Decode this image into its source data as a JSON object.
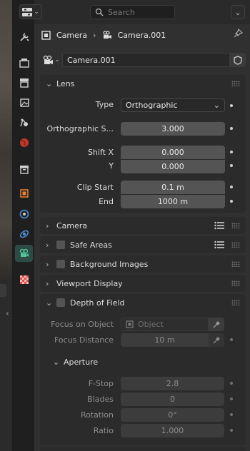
{
  "header": {
    "search_placeholder": "Search"
  },
  "breadcrumb": {
    "object": "Camera",
    "data": "Camera.001"
  },
  "datablock": {
    "name": "Camera.001"
  },
  "lens": {
    "title": "Lens",
    "type_label": "Type",
    "type_value": "Orthographic",
    "ortho_scale_label": "Orthographic S...",
    "ortho_scale_value": "3.000",
    "shift_x_label": "Shift X",
    "shift_x_value": "0.000",
    "shift_y_label": "Y",
    "shift_y_value": "0.000",
    "clip_start_label": "Clip Start",
    "clip_start_value": "0.1 m",
    "clip_end_label": "End",
    "clip_end_value": "1000 m"
  },
  "panels": {
    "camera": "Camera",
    "safe_areas": "Safe Areas",
    "background_images": "Background Images",
    "viewport_display": "Viewport Display",
    "depth_of_field": "Depth of Field"
  },
  "dof": {
    "focus_object_label": "Focus on Object",
    "focus_object_placeholder": "Object",
    "focus_distance_label": "Focus Distance",
    "focus_distance_value": "10 m",
    "aperture_title": "Aperture",
    "fstop_label": "F-Stop",
    "fstop_value": "2.8",
    "blades_label": "Blades",
    "blades_value": "0",
    "rotation_label": "Rotation",
    "rotation_value": "0°",
    "ratio_label": "Ratio",
    "ratio_value": "1.000"
  },
  "colors": {
    "accent_active_tab": "#2d4a44",
    "camera_icon": "#53c29a",
    "object_icon": "#e8843a",
    "physics_icon": "#4e8fd6"
  },
  "icons": {
    "tabs": [
      "tool-icon",
      "render-icon",
      "output-icon",
      "view-layer-icon",
      "scene-icon",
      "world-icon",
      "collection-icon",
      "object-icon",
      "modifier-icon",
      "particles-icon",
      "physics-icon",
      "camera-data-icon",
      "texture-icon"
    ]
  }
}
